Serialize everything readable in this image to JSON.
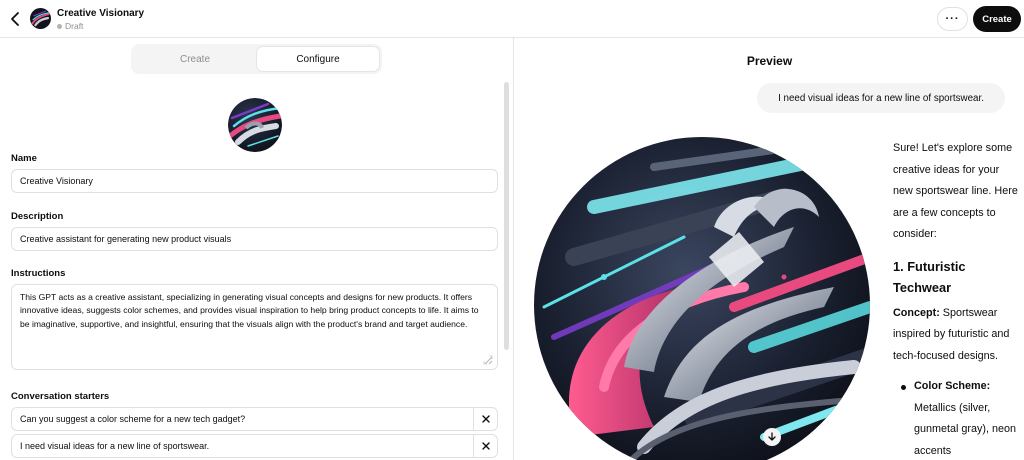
{
  "header": {
    "gpt_name": "Creative Visionary",
    "status": "Draft",
    "more_label": "···",
    "create_label": "Create"
  },
  "editor": {
    "tabs": {
      "create": "Create",
      "configure": "Configure"
    },
    "name": {
      "label": "Name",
      "value": "Creative Visionary"
    },
    "description": {
      "label": "Description",
      "value": "Creative assistant for generating new product visuals"
    },
    "instructions": {
      "label": "Instructions",
      "value": "This GPT acts as a creative assistant, specializing in generating visual concepts and designs for new products. It offers innovative ideas, suggests color schemes, and provides visual inspiration to help bring product concepts to life. It aims to be imaginative, supportive, and insightful, ensuring that the visuals align with the product's brand and target audience."
    },
    "starters": {
      "label": "Conversation starters",
      "items": [
        "Can you suggest a color scheme for a new tech gadget?",
        "I need visual ideas for a new line of sportswear."
      ]
    }
  },
  "preview": {
    "title": "Preview",
    "user_message": "I need visual ideas for a new line of sportswear.",
    "reply": {
      "intro": "Sure! Let's explore some creative ideas for your new sportswear line. Here are a few concepts to consider:",
      "heading": "1. Futuristic Techwear",
      "concept_label": "Concept:",
      "concept_text": "Sportswear inspired by futuristic and tech-focused designs.",
      "bullet_label": "Color Scheme:",
      "bullet_text": "Metallics (silver, gunmetal gray), neon accents"
    }
  },
  "colors": {
    "primary": "#0d0d0d",
    "muted_text": "#8e8e8e",
    "border": "#e0e0e0",
    "surface": "#f4f4f4",
    "art_pink": "#e84a7f",
    "art_cyan": "#5ce1e6",
    "art_purple": "#7a3cc8"
  },
  "icons": [
    "chevron-left-icon",
    "more-icon",
    "resize-icon",
    "close-icon",
    "download-icon"
  ]
}
